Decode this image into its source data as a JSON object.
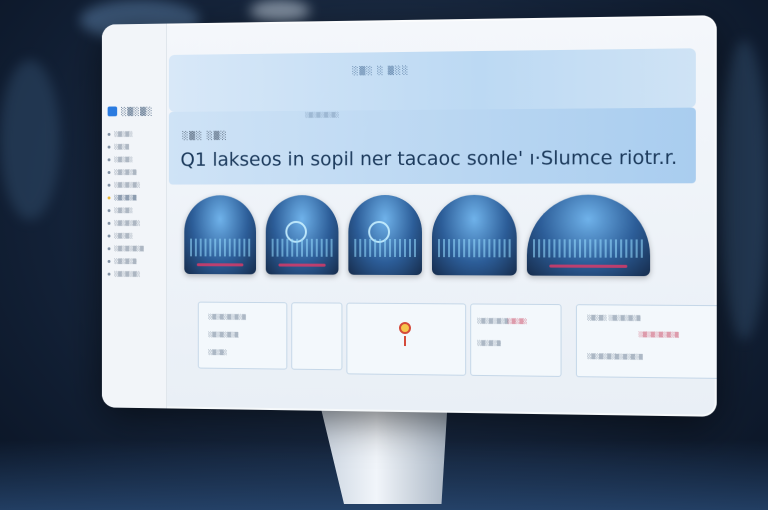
{
  "header": {
    "title": "░▒░ ░ ▒░░",
    "subtitle": "░▒░▒░▒░▒░"
  },
  "sidebar": {
    "logo": "░▒░▒░",
    "items": [
      {
        "label": "░▒░▒░",
        "active": false
      },
      {
        "label": "░▒░▒",
        "active": false
      },
      {
        "label": "░▒░▒░",
        "active": false
      },
      {
        "label": "░▒░▒░▒",
        "active": false
      },
      {
        "label": "░▒░▒░▒░",
        "active": false
      },
      {
        "label": "░▒░▒░▒",
        "active": true
      },
      {
        "label": "░▒░▒░",
        "active": false
      },
      {
        "label": "░▒░▒░▒░",
        "active": false
      },
      {
        "label": "░▒░▒░",
        "active": false
      },
      {
        "label": "░▒░▒░▒░▒",
        "active": false
      },
      {
        "label": "░▒░▒░▒",
        "active": false
      },
      {
        "label": "░▒░▒░▒░",
        "active": false
      }
    ]
  },
  "hero": {
    "kicker": "░▒░ ░▒░",
    "headline": "Q1 lakseos in sopil ner tacaoc sonle' ı·Slumce riotr.r."
  },
  "cards": [
    {
      "icon": "dashboard-preview"
    },
    {
      "icon": "search-preview"
    },
    {
      "icon": "settings-preview"
    },
    {
      "icon": "chart-preview"
    },
    {
      "icon": "analytics-preview"
    }
  ],
  "panels": {
    "left": {
      "row1": "░▒░▒░▒░▒░▒",
      "row2": "░▒░▒░▒░▒",
      "row3": "░▒░▒░"
    },
    "mid": {
      "row1": "░▒░▒░▒░▒",
      "row2": "░▒░▒░",
      "row3": "░▒░▒░▒"
    },
    "right": {
      "row1": "░▒░▒░ ░▒░▒░▒░▒",
      "row2": "░▒░▒░▒░▒░▒",
      "row3": "░▒░▒░▒░▒░▒░▒░▒"
    }
  },
  "colors": {
    "accent": "#2b7be0",
    "alert": "#c94662",
    "active": "#e8b534"
  }
}
